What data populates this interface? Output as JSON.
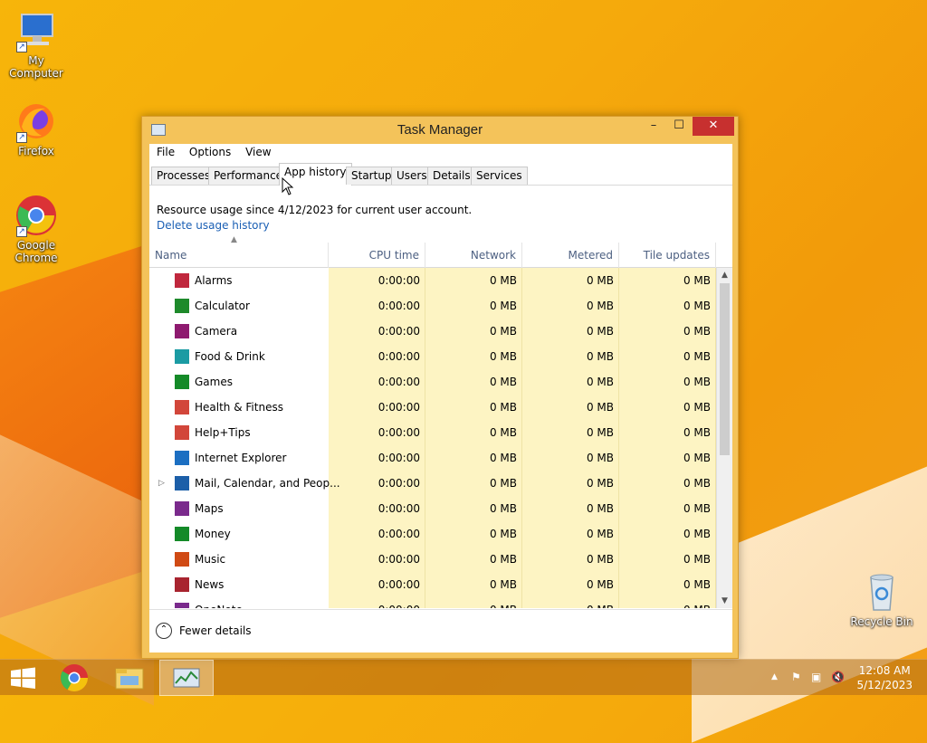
{
  "desktop": {
    "icons": [
      {
        "label": "My Computer"
      },
      {
        "label": "Firefox"
      },
      {
        "label": "Google Chrome"
      },
      {
        "label": "Recycle Bin"
      }
    ]
  },
  "window": {
    "title": "Task Manager",
    "controls": {
      "minimize": "–",
      "maximize": "☐",
      "close": "✕"
    },
    "menu": [
      "File",
      "Options",
      "View"
    ],
    "tabs": [
      "Processes",
      "Performance",
      "App history",
      "Startup",
      "Users",
      "Details",
      "Services"
    ],
    "active_tab": "App history",
    "info": {
      "text": "Resource usage since 4/12/2023 for current user account.",
      "link": "Delete usage history"
    },
    "columns": [
      "Name",
      "CPU time",
      "Network",
      "Metered network",
      "Tile updates"
    ],
    "rows": [
      {
        "name": "Alarms",
        "icon": "alarms-icon",
        "color": "#c0273d",
        "cpu": "0:00:00",
        "network": "0 MB",
        "metered": "0 MB",
        "tile": "0 MB"
      },
      {
        "name": "Calculator",
        "icon": "calculator-icon",
        "color": "#1e8a2b",
        "cpu": "0:00:00",
        "network": "0 MB",
        "metered": "0 MB",
        "tile": "0 MB"
      },
      {
        "name": "Camera",
        "icon": "camera-icon",
        "color": "#8e1a6f",
        "cpu": "0:00:00",
        "network": "0 MB",
        "metered": "0 MB",
        "tile": "0 MB"
      },
      {
        "name": "Food & Drink",
        "icon": "food-drink-icon",
        "color": "#1b9ba3",
        "cpu": "0:00:00",
        "network": "0 MB",
        "metered": "0 MB",
        "tile": "0 MB"
      },
      {
        "name": "Games",
        "icon": "games-icon",
        "color": "#148a28",
        "cpu": "0:00:00",
        "network": "0 MB",
        "metered": "0 MB",
        "tile": "0 MB"
      },
      {
        "name": "Health & Fitness",
        "icon": "health-fitness-icon",
        "color": "#d2463a",
        "cpu": "0:00:00",
        "network": "0 MB",
        "metered": "0 MB",
        "tile": "0 MB"
      },
      {
        "name": "Help+Tips",
        "icon": "help-tips-icon",
        "color": "#d2463a",
        "cpu": "0:00:00",
        "network": "0 MB",
        "metered": "0 MB",
        "tile": "0 MB"
      },
      {
        "name": "Internet Explorer",
        "icon": "internet-explorer-icon",
        "color": "#1c6fc2",
        "cpu": "0:00:00",
        "network": "0 MB",
        "metered": "0 MB",
        "tile": "0 MB"
      },
      {
        "name": "Mail, Calendar, and Peop...",
        "icon": "mail-icon",
        "color": "#1c5fa8",
        "expandable": true,
        "cpu": "0:00:00",
        "network": "0 MB",
        "metered": "0 MB",
        "tile": "0 MB"
      },
      {
        "name": "Maps",
        "icon": "maps-icon",
        "color": "#7a2a8c",
        "cpu": "0:00:00",
        "network": "0 MB",
        "metered": "0 MB",
        "tile": "0 MB"
      },
      {
        "name": "Money",
        "icon": "money-icon",
        "color": "#148a28",
        "cpu": "0:00:00",
        "network": "0 MB",
        "metered": "0 MB",
        "tile": "0 MB"
      },
      {
        "name": "Music",
        "icon": "music-icon",
        "color": "#d04a14",
        "cpu": "0:00:00",
        "network": "0 MB",
        "metered": "0 MB",
        "tile": "0 MB"
      },
      {
        "name": "News",
        "icon": "news-icon",
        "color": "#a8242f",
        "cpu": "0:00:00",
        "network": "0 MB",
        "metered": "0 MB",
        "tile": "0 MB"
      },
      {
        "name": "OneNote",
        "icon": "onenote-icon",
        "color": "#7a2a8c",
        "cpu": "0:00:00",
        "network": "0 MB",
        "metered": "0 MB",
        "tile": "0 MB"
      }
    ],
    "footer": {
      "label": "Fewer details"
    }
  },
  "taskbar": {
    "items": [
      "start-button",
      "chrome",
      "file-explorer",
      "task-manager"
    ],
    "clock": {
      "time": "12:08 AM",
      "date": "5/12/2023"
    }
  }
}
